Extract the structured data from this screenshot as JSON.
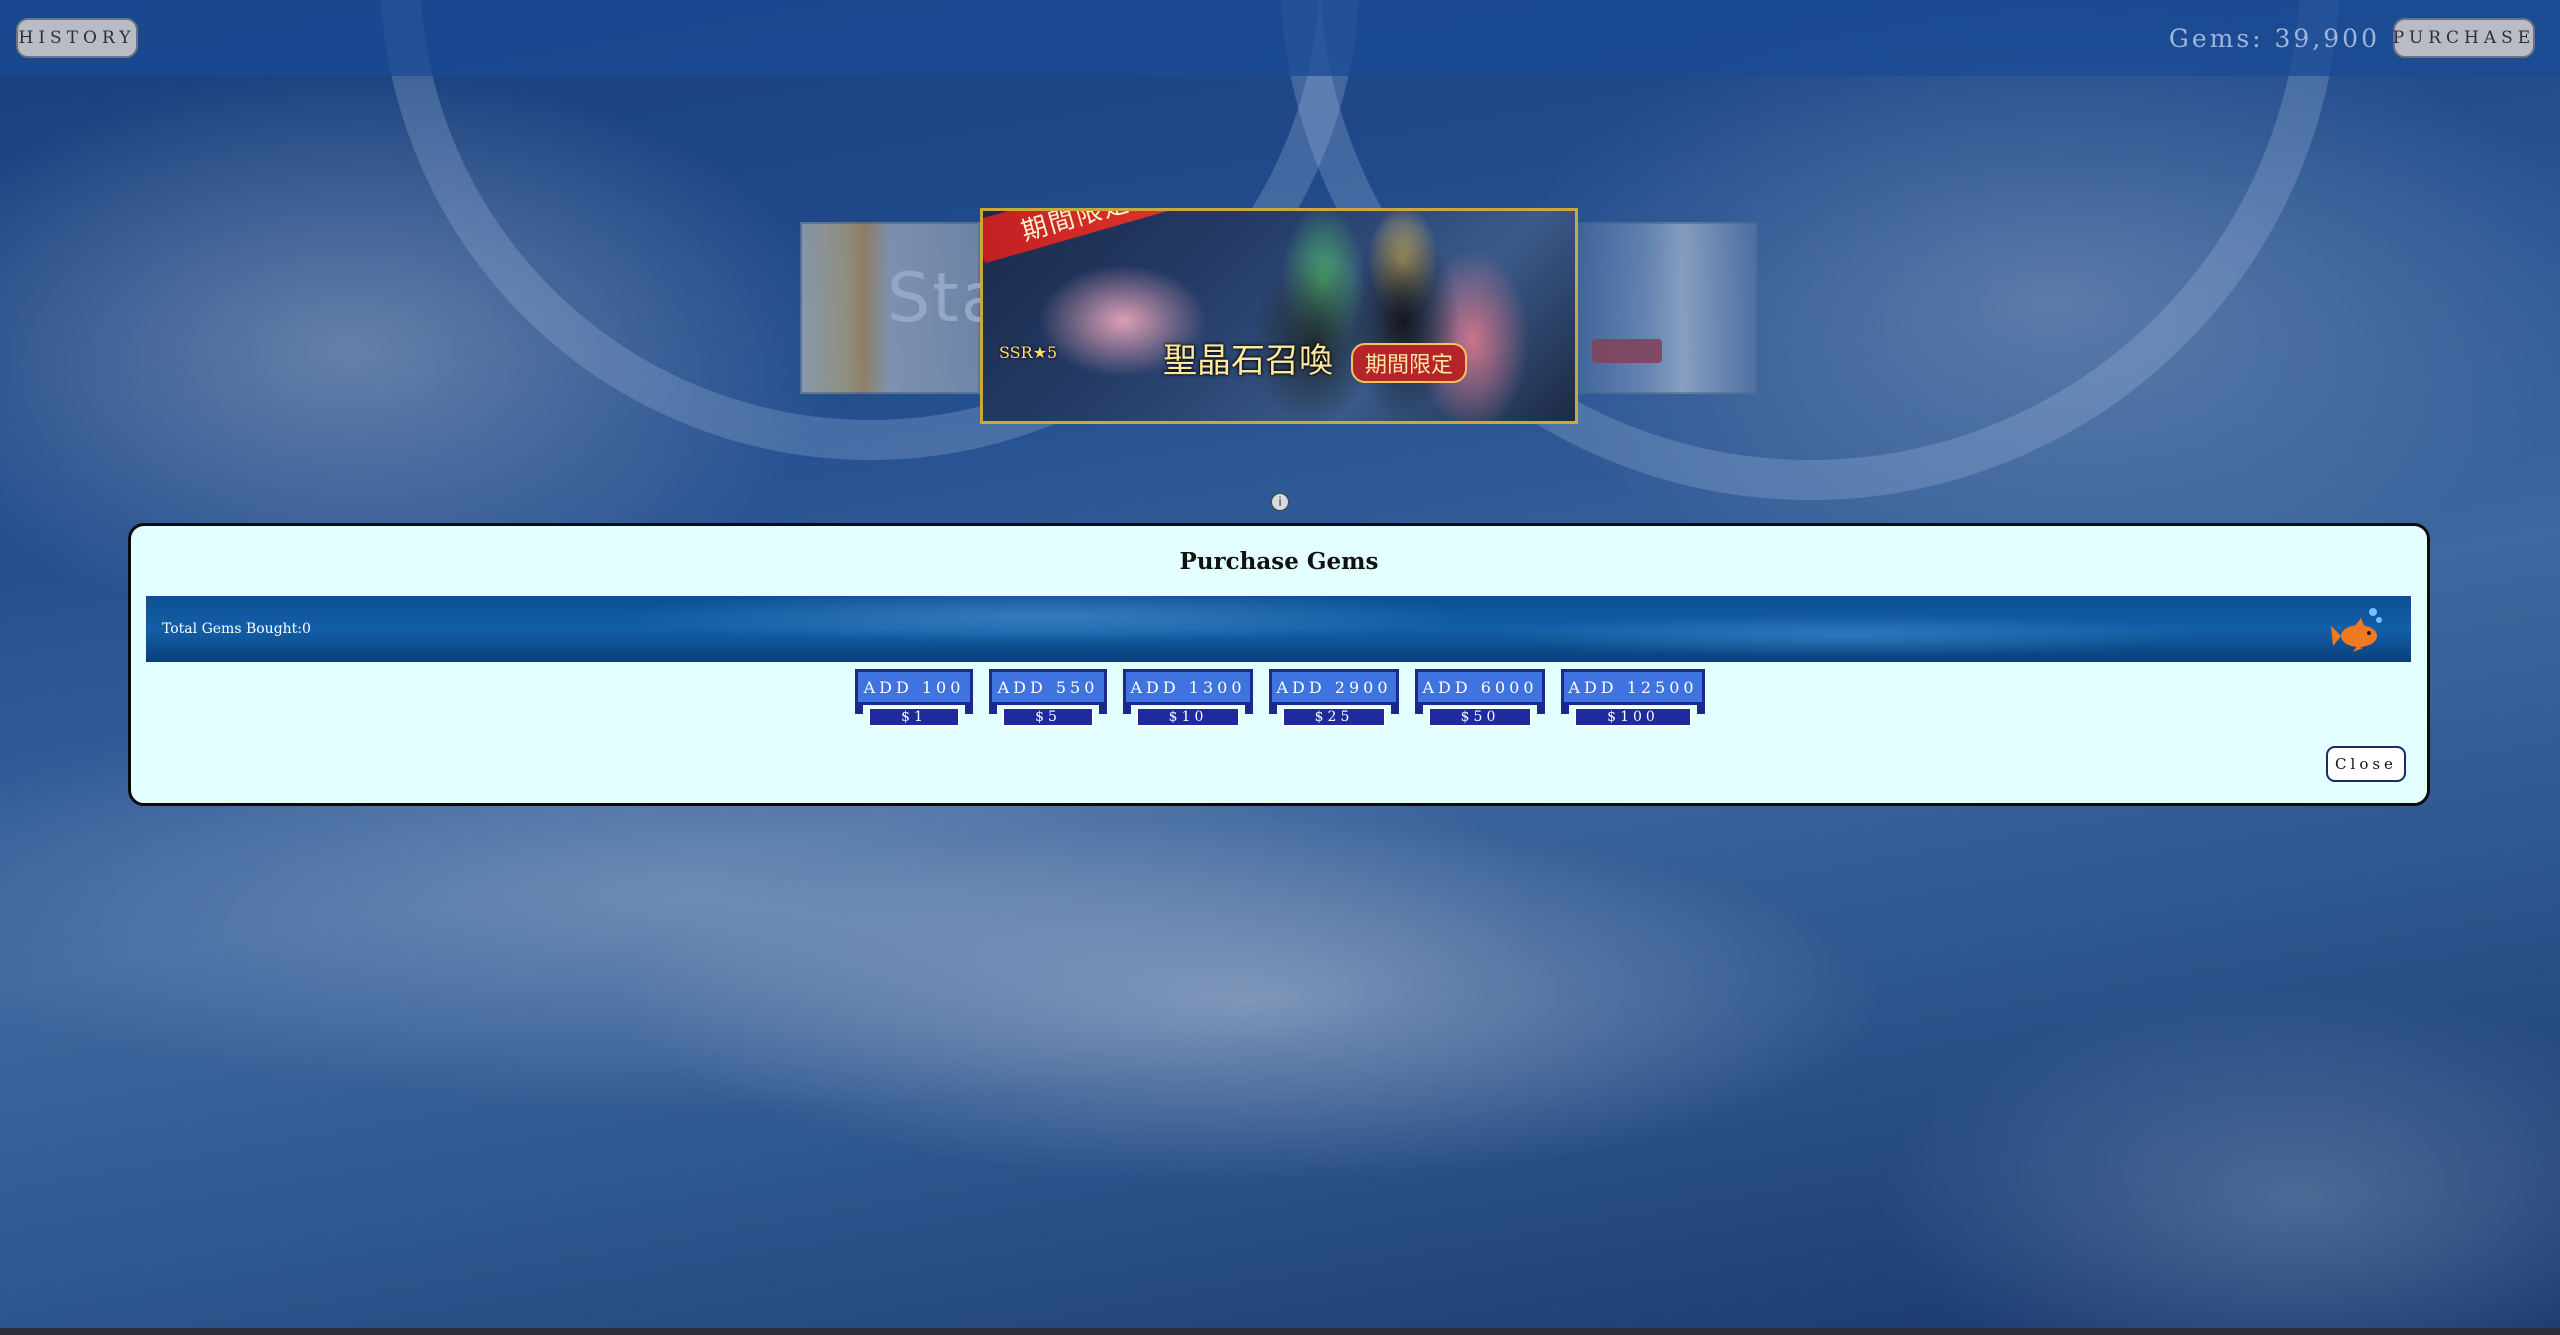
{
  "header": {
    "history_label": "HISTORY",
    "gems_label": "Gems: 39,900",
    "purchase_label": "PURCHASE"
  },
  "carousel": {
    "left_banner_text": "Sta",
    "main_banner": {
      "ribbon_text": "期間限定",
      "caption_text": "聖晶石召喚",
      "tag_text": "期間限定",
      "ssr_text": "SSR★5"
    },
    "info_icon": "info-icon"
  },
  "modal": {
    "title": "Purchase Gems",
    "stats_text": "Total Gems Bought:0",
    "packs": [
      {
        "add_label": "ADD 100",
        "price_label": "$1"
      },
      {
        "add_label": "ADD 550",
        "price_label": "$5"
      },
      {
        "add_label": "ADD 1300",
        "price_label": "$10"
      },
      {
        "add_label": "ADD 2900",
        "price_label": "$25"
      },
      {
        "add_label": "ADD 6000",
        "price_label": "$50"
      },
      {
        "add_label": "ADD 12500",
        "price_label": "$100"
      }
    ],
    "close_label": "Close"
  },
  "colors": {
    "modal_bg": "#e3ffff",
    "pack_button": "#3f74e0",
    "pack_price": "#1f2a9e",
    "stats_bar": "#135fa8",
    "fish": "#f07a22"
  }
}
